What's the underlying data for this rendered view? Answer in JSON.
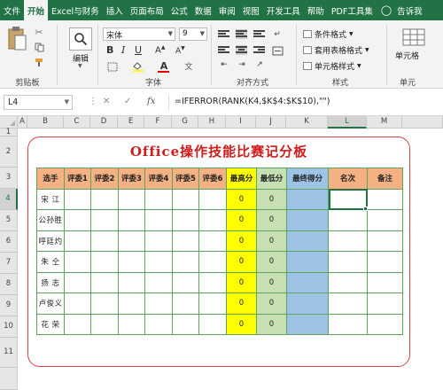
{
  "ribbon_tabs": [
    "文件",
    "开始",
    "Excel与财务",
    "插入",
    "页面布局",
    "公式",
    "数据",
    "审阅",
    "视图",
    "开发工具",
    "帮助",
    "PDF工具集"
  ],
  "active_tab": "开始",
  "tell_me": "告诉我",
  "groups": {
    "clipboard": "剪贴板",
    "editing": "编辑",
    "font": "字体",
    "alignment": "对齐方式",
    "styles": "样式",
    "cells": "单元"
  },
  "font_name": "宋体",
  "font_size": "9",
  "styles_items": [
    "条件格式",
    "套用表格格式",
    "单元格样式"
  ],
  "cells_label": "单元格",
  "accent_color": "#217346",
  "name_box": "L4",
  "formula": "=IFERROR(RANK(K4,$K$4:$K$10),\"\")",
  "columns": [
    "A",
    "B",
    "C",
    "D",
    "E",
    "F",
    "G",
    "H",
    "I",
    "J",
    "K",
    "L",
    "M"
  ],
  "rows": [
    "1",
    "2",
    "3",
    "4",
    "5",
    "6",
    "7",
    "8",
    "9",
    "10",
    "11"
  ],
  "sheet_title": "Office操作技能比赛记分板",
  "table": {
    "headers": [
      "选手",
      "评委1",
      "评委2",
      "评委3",
      "评委4",
      "评委5",
      "评委6",
      "最高分",
      "最低分",
      "最终得分",
      "名次",
      "备注"
    ],
    "rows": [
      {
        "name": "宋  江",
        "max": "0",
        "min": "0"
      },
      {
        "name": "公孙胜",
        "max": "0",
        "min": "0"
      },
      {
        "name": "呼廷灼",
        "max": "0",
        "min": "0"
      },
      {
        "name": "朱  仝",
        "max": "0",
        "min": "0"
      },
      {
        "name": "扬  志",
        "max": "0",
        "min": "0"
      },
      {
        "name": "卢俊义",
        "max": "0",
        "min": "0"
      },
      {
        "name": "花  荣",
        "max": "0",
        "min": "0"
      }
    ]
  }
}
